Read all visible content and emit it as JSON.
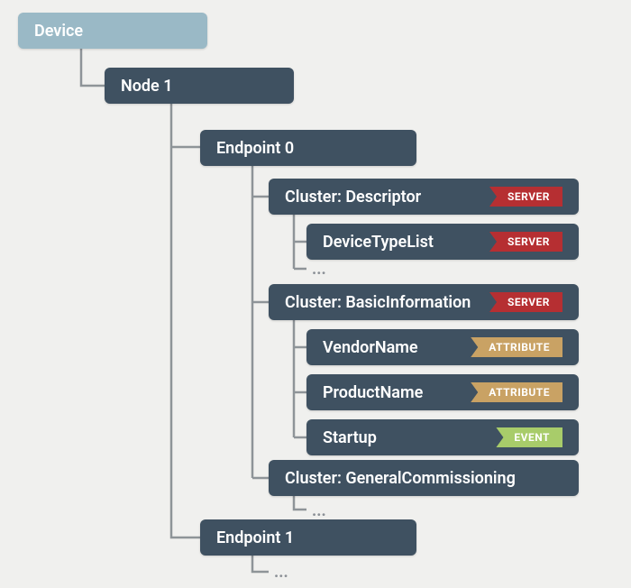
{
  "tree": {
    "device": "Device",
    "node1": "Node 1",
    "endpoint0": "Endpoint 0",
    "cluster_descriptor": "Cluster: Descriptor",
    "devicetypelist": "DeviceTypeList",
    "cluster_basicinfo": "Cluster: BasicInformation",
    "vendorname": "VendorName",
    "productname": "ProductName",
    "startup": "Startup",
    "cluster_genc": "Cluster: GeneralCommissioning",
    "endpoint1": "Endpoint 1",
    "ellipsis": "..."
  },
  "badges": {
    "server": "SERVER",
    "attribute": "ATTRIBUTE",
    "event": "EVENT"
  },
  "colors": {
    "node_bg": "#3f5161",
    "root_bg": "#9ab9c6",
    "server": "#b62f32",
    "attribute": "#c9a264",
    "event": "#a8cc6a",
    "connector": "#8e9498"
  }
}
